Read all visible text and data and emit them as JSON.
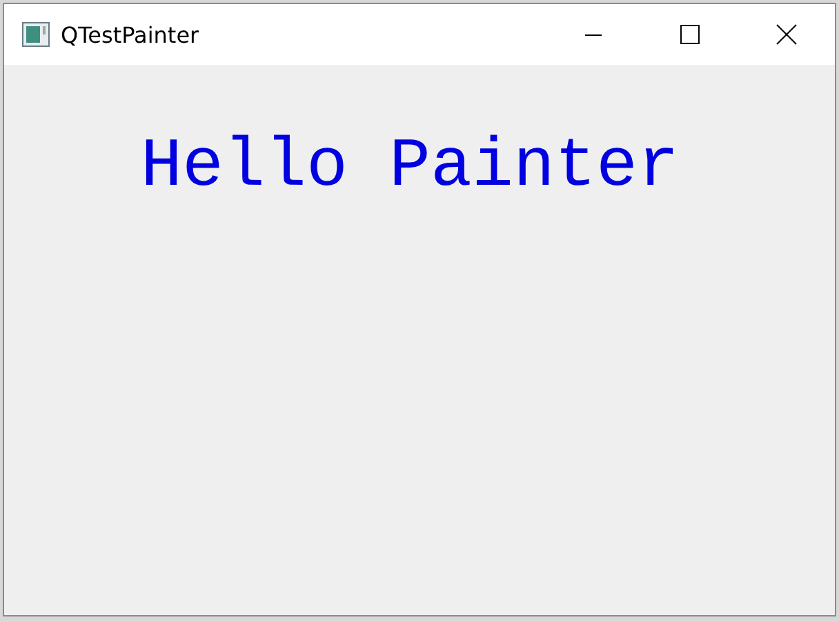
{
  "window": {
    "title": "QTestPainter"
  },
  "canvas": {
    "text": "Hello Painter"
  }
}
